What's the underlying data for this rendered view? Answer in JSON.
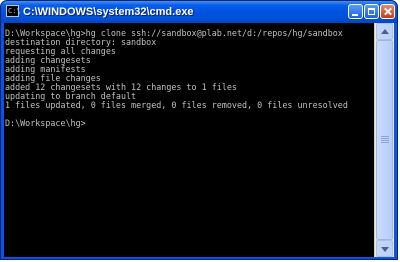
{
  "window": {
    "title": "C:\\WINDOWS\\system32\\cmd.exe",
    "icon": "console-app-icon",
    "icon_text": "C:\\"
  },
  "console": {
    "lines": [
      "D:\\Workspace\\hg>hg clone ssh://sandbox@plab.net/d:/repos/hg/sandbox",
      "destination directory: sandbox",
      "requesting all changes",
      "adding changesets",
      "adding manifests",
      "adding file changes",
      "added 12 changesets with 12 changes to 1 files",
      "updating to branch default",
      "1 files updated, 0 files merged, 0 files removed, 0 files unresolved",
      "",
      "D:\\Workspace\\hg>"
    ]
  },
  "colors": {
    "titlebar": "#0054e3",
    "console_bg": "#000000",
    "console_text": "#c0c0c0"
  }
}
